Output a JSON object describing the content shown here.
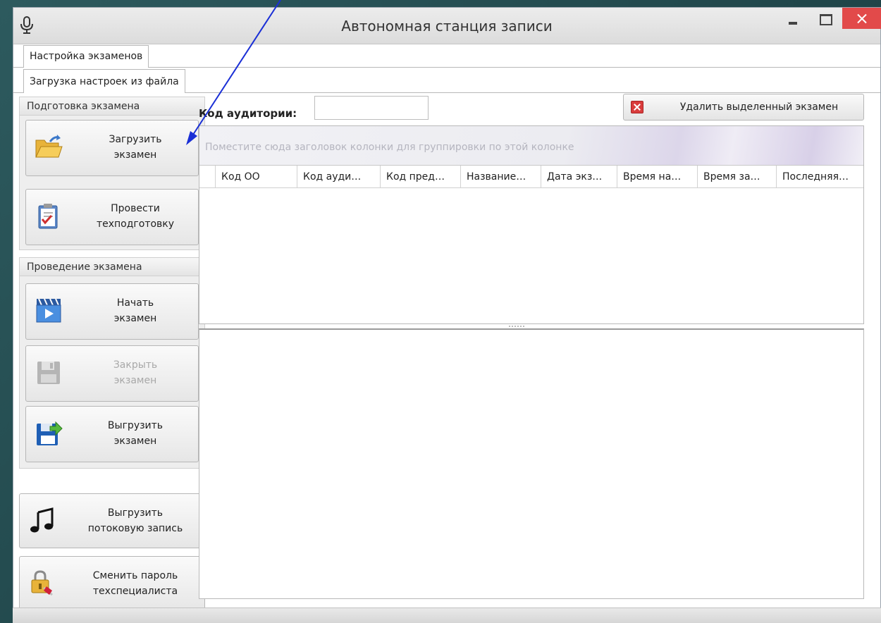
{
  "window": {
    "title": "Автономная станция записи"
  },
  "tabs": {
    "top": "Настройка экзаменов",
    "sub": "Загрузка настроек из файла"
  },
  "left_panel": {
    "prep_group": {
      "header": "Подготовка экзамена",
      "load_exam": "Загрузить\nэкзамен",
      "tech_prep": "Провести\nтехподготовку"
    },
    "exam_group": {
      "header": "Проведение экзамена",
      "start_exam": "Начать\nэкзамен",
      "close_exam": "Закрыть\nэкзамен",
      "export_exam": "Выгрузить\nэкзамен"
    },
    "export_stream": "Выгрузить\nпотоковую запись",
    "change_password": "Сменить пароль\nтехспециалиста"
  },
  "toolbar": {
    "room_code_label": "Код аудитории:",
    "room_code_value": "",
    "delete_label": "Удалить выделенный экзамен"
  },
  "grid": {
    "group_hint": "Поместите сюда заголовок колонки для группировки по этой колонке",
    "columns": [
      "Код ОО",
      "Код ауди…",
      "Код пред…",
      "Название…",
      "Дата экз…",
      "Время на…",
      "Время за…",
      "Последняя…"
    ]
  },
  "colors": {
    "background": "#2d5a5e",
    "close_button": "#e24a4a",
    "arrow": "#1a2fd6"
  }
}
